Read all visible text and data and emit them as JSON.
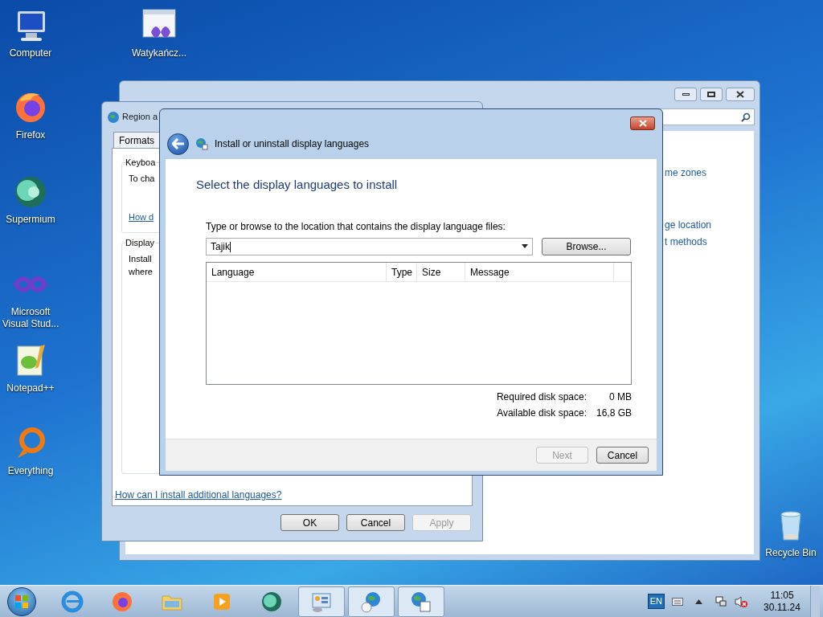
{
  "desktop_icons": [
    {
      "label": "Computer"
    },
    {
      "label": "Watykańcz..."
    },
    {
      "label": "Firefox"
    },
    {
      "label": "Supermium"
    },
    {
      "label": "Microsoft Visual Stud..."
    },
    {
      "label": "Notepad++"
    },
    {
      "label": "Everything"
    },
    {
      "label": "Recycle Bin"
    }
  ],
  "back_window": {
    "links": [
      "me zones",
      "ge location",
      "t methods"
    ]
  },
  "region_window": {
    "title": "Region a",
    "tabs": [
      {
        "label": "Formats",
        "selected": false
      }
    ],
    "groups": [
      {
        "title": "Keyboa",
        "text": "To cha",
        "link": "How d"
      },
      {
        "title": "Display",
        "text": "Install\nwhere"
      }
    ],
    "help_link": "How can I install additional languages?",
    "buttons": [
      {
        "label": "OK",
        "disabled": false
      },
      {
        "label": "Cancel",
        "disabled": false
      },
      {
        "label": "Apply",
        "disabled": true
      }
    ]
  },
  "dialog": {
    "title": "Install or uninstall display languages",
    "heading": "Select the display languages to install",
    "prompt": "Type or browse to the location that contains the display language files:",
    "path_value": "Tajik",
    "browse": "Browse...",
    "columns": [
      "Language",
      "Type",
      "Size",
      "Message"
    ],
    "disk": [
      {
        "label": "Required disk space:",
        "value": "0 MB"
      },
      {
        "label": "Available disk space:",
        "value": "16,8 GB"
      }
    ],
    "buttons": [
      {
        "label": "Next",
        "disabled": true
      },
      {
        "label": "Cancel",
        "disabled": false
      }
    ]
  },
  "taskbar": {
    "items": [
      {
        "open": false
      },
      {
        "open": false
      },
      {
        "open": false
      },
      {
        "open": false
      },
      {
        "open": false
      },
      {
        "open": true
      },
      {
        "open": true
      },
      {
        "open": true
      }
    ],
    "language": "EN",
    "time": "11:05",
    "date": "30.11.24"
  }
}
